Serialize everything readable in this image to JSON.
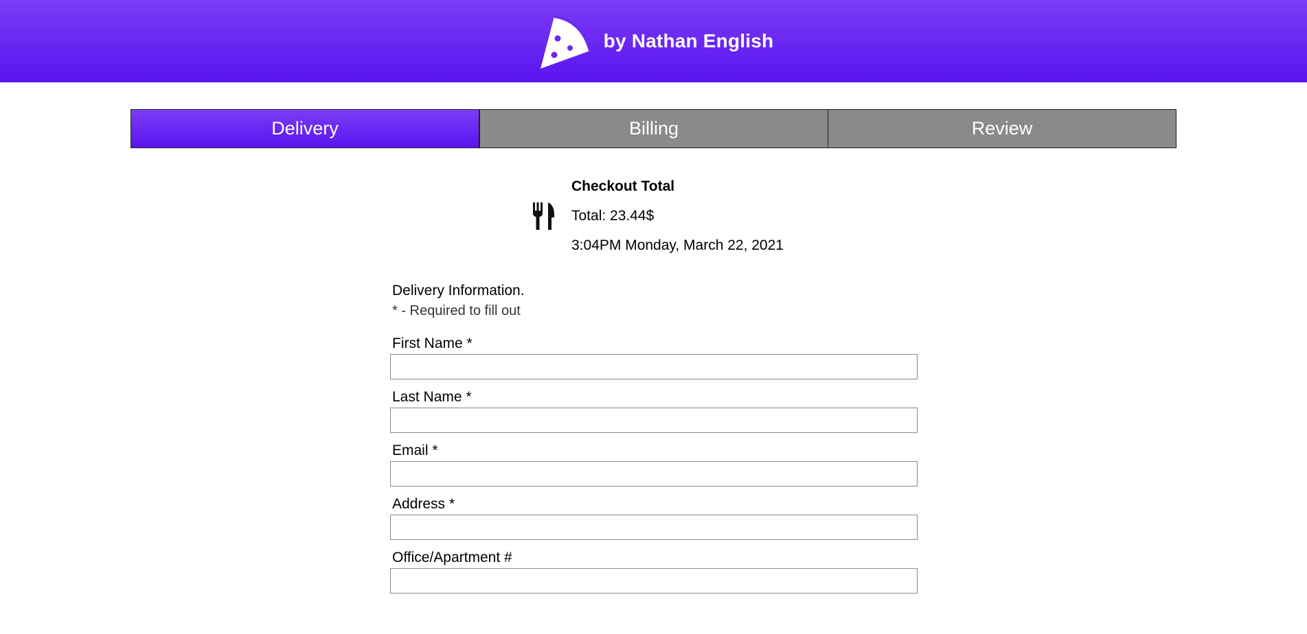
{
  "header": {
    "brand_text": "by Nathan English",
    "logo_icon": "pizza-slice-icon",
    "gradient_top": "#7b3cf6",
    "gradient_bottom": "#5a14ee"
  },
  "tabs": [
    {
      "label": "Delivery",
      "active": true
    },
    {
      "label": "Billing",
      "active": false
    },
    {
      "label": "Review",
      "active": false
    }
  ],
  "summary": {
    "icon": "fork-knife-icon",
    "title": "Checkout Total",
    "total": "Total: 23.44$",
    "datetime": "3:04PM Monday, March 22, 2021"
  },
  "form": {
    "title": "Delivery Information.",
    "note": "* - Required to fill out",
    "fields": [
      {
        "label": "First Name *",
        "value": "",
        "placeholder": ""
      },
      {
        "label": "Last Name *",
        "value": "",
        "placeholder": ""
      },
      {
        "label": "Email *",
        "value": "",
        "placeholder": ""
      },
      {
        "label": "Address *",
        "value": "",
        "placeholder": ""
      },
      {
        "label": "Office/Apartment #",
        "value": "",
        "placeholder": ""
      }
    ]
  },
  "colors": {
    "accent": "#6a2af2",
    "tab_inactive": "#8a8a8a"
  }
}
